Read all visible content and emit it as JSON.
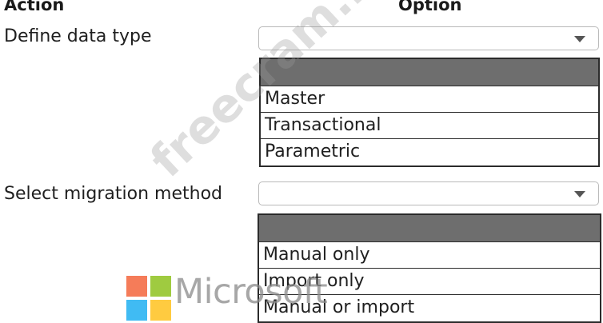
{
  "headers": {
    "action": "Action",
    "option": "Option"
  },
  "rows": [
    {
      "action_label": "Define data type",
      "select": {
        "value": "",
        "icon": "chevron-down-icon"
      },
      "options": [
        "",
        "Master",
        "Transactional",
        "Parametric"
      ]
    },
    {
      "action_label": "Select migration method",
      "select": {
        "value": "",
        "icon": "chevron-down-icon"
      },
      "options": [
        "",
        "Manual only",
        "Import only",
        "Manual or import"
      ]
    }
  ],
  "logo": {
    "text": "Microsoft",
    "colors": [
      "#f25022",
      "#7fba00",
      "#00a4ef",
      "#ffb900"
    ]
  },
  "watermark": "freecram.net"
}
